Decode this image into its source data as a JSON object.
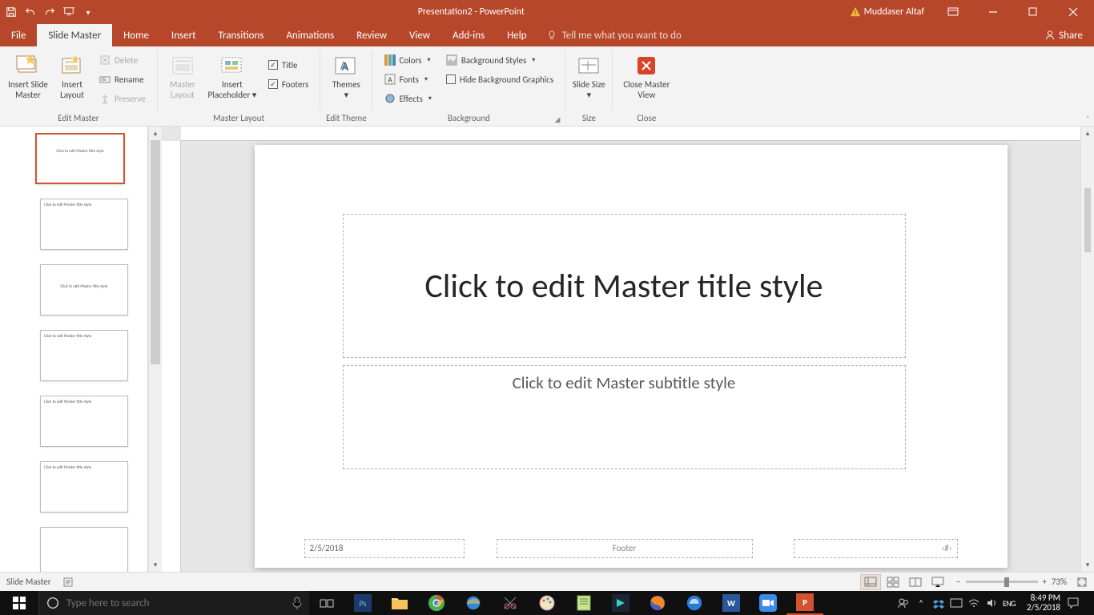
{
  "titlebar": {
    "doc_title": "Presentation2 - PowerPoint",
    "user": "Muddaser Altaf"
  },
  "tabs": {
    "file": "File",
    "slide_master": "Slide Master",
    "home": "Home",
    "insert": "Insert",
    "transitions": "Transitions",
    "animations": "Animations",
    "review": "Review",
    "view": "View",
    "addins": "Add-ins",
    "help": "Help",
    "tell_me": "Tell me what you want to do",
    "share": "Share"
  },
  "ribbon": {
    "edit_master": {
      "insert_slide": "Insert Slide Master",
      "insert_layout": "Insert Layout",
      "delete": "Delete",
      "rename": "Rename",
      "preserve": "Preserve",
      "group": "Edit Master"
    },
    "master_layout": {
      "master_layout": "Master Layout",
      "insert_placeholder": "Insert Placeholder",
      "title": "Title",
      "footers": "Footers",
      "group": "Master Layout"
    },
    "edit_theme": {
      "themes": "Themes",
      "group": "Edit Theme"
    },
    "background": {
      "colors": "Colors",
      "fonts": "Fonts",
      "effects": "Effects",
      "bg_styles": "Background Styles",
      "hide_bg": "Hide Background Graphics",
      "group": "Background"
    },
    "size": {
      "slide_size": "Slide Size",
      "group": "Size"
    },
    "close": {
      "close_master": "Close Master View",
      "group": "Close"
    }
  },
  "slide": {
    "title_ph": "Click to edit Master title style",
    "subtitle_ph": "Click to edit Master subtitle style",
    "date": "2/5/2018",
    "footer": "Footer",
    "num": "‹#›"
  },
  "status": {
    "mode": "Slide Master",
    "zoom": "73%"
  },
  "taskbar": {
    "search_ph": "Type here to search",
    "time": "8:49 PM",
    "date": "2/5/2018"
  },
  "thumbs": {
    "master": "Click to edit Master title style",
    "layout": "Click to edit Master title style"
  }
}
